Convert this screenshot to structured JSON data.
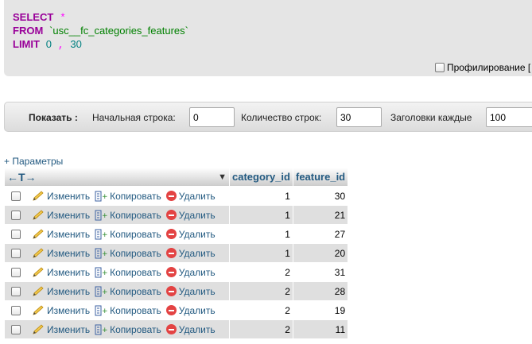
{
  "sql": {
    "kw_select": "SELECT",
    "star": "*",
    "kw_from": "FROM",
    "table": "`usc__fc_categories_features`",
    "kw_limit": "LIMIT",
    "limit_start": "0",
    "limit_sep": ",",
    "limit_count": "30"
  },
  "profiling_label": "Профилирование [",
  "nav": {
    "show_label": "Показать :",
    "start_label": "Начальная строка:",
    "start_value": "0",
    "rows_label": "Количество строк:",
    "rows_value": "30",
    "headers_label": "Заголовки каждые",
    "headers_value": "100"
  },
  "params_link": "+ Параметры",
  "table": {
    "arrows": "←T→",
    "columns": [
      "category_id",
      "feature_id"
    ],
    "action_edit": "Изменить",
    "action_copy": "Копировать",
    "action_delete": "Удалить",
    "rows": [
      {
        "category_id": "1",
        "feature_id": "30"
      },
      {
        "category_id": "1",
        "feature_id": "21"
      },
      {
        "category_id": "1",
        "feature_id": "27"
      },
      {
        "category_id": "1",
        "feature_id": "20"
      },
      {
        "category_id": "2",
        "feature_id": "31"
      },
      {
        "category_id": "2",
        "feature_id": "28"
      },
      {
        "category_id": "2",
        "feature_id": "19"
      },
      {
        "category_id": "2",
        "feature_id": "11"
      }
    ]
  }
}
